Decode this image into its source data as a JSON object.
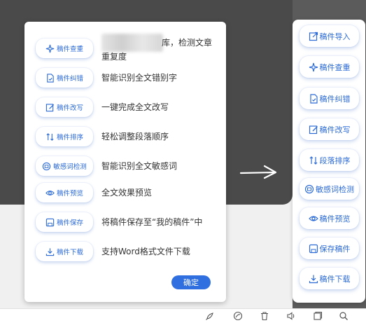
{
  "colors": {
    "accent": "#2c6bd6",
    "button": "#2f6fe0",
    "overlay": "#4a4a4a"
  },
  "dialog": {
    "rows": [
      {
        "label": "稿件查重",
        "icon": "sparkle-icon",
        "desc": "库，检测文章重复度"
      },
      {
        "label": "稿件纠错",
        "icon": "doc-check-icon",
        "desc": "智能识别全文错别字"
      },
      {
        "label": "稿件改写",
        "icon": "edit-icon",
        "desc": "一键完成全文改写"
      },
      {
        "label": "稿件排序",
        "icon": "sort-icon",
        "desc": "轻松调整段落顺序"
      },
      {
        "label": "敏感词检测",
        "icon": "sensitive-icon",
        "desc": "智能识别全文敏感词"
      },
      {
        "label": "稿件预览",
        "icon": "eye-icon",
        "desc": "全文效果预览"
      },
      {
        "label": "稿件保存",
        "icon": "save-icon",
        "desc": "将稿件保存至“我的稿件”中"
      },
      {
        "label": "稿件下载",
        "icon": "download-icon",
        "desc": "支持Word格式文件下载"
      }
    ],
    "confirm_label": "确定"
  },
  "toolbar": {
    "items": [
      {
        "label": "稿件导入",
        "icon": "import-icon"
      },
      {
        "label": "稿件查重",
        "icon": "sparkle-icon"
      },
      {
        "label": "稿件纠错",
        "icon": "doc-check-icon"
      },
      {
        "label": "稿件改写",
        "icon": "edit-icon"
      },
      {
        "label": "段落排序",
        "icon": "sort-icon"
      },
      {
        "label": "敏感词检测",
        "icon": "sensitive-icon"
      },
      {
        "label": "稿件预览",
        "icon": "eye-icon"
      },
      {
        "label": "保存稿件",
        "icon": "save-icon"
      },
      {
        "label": "稿件下载",
        "icon": "download-icon"
      }
    ]
  },
  "bottom_bar": {
    "icons": [
      "rocket-icon",
      "palette-icon",
      "trash-icon",
      "speaker-icon",
      "window-icon",
      "search-icon"
    ]
  }
}
